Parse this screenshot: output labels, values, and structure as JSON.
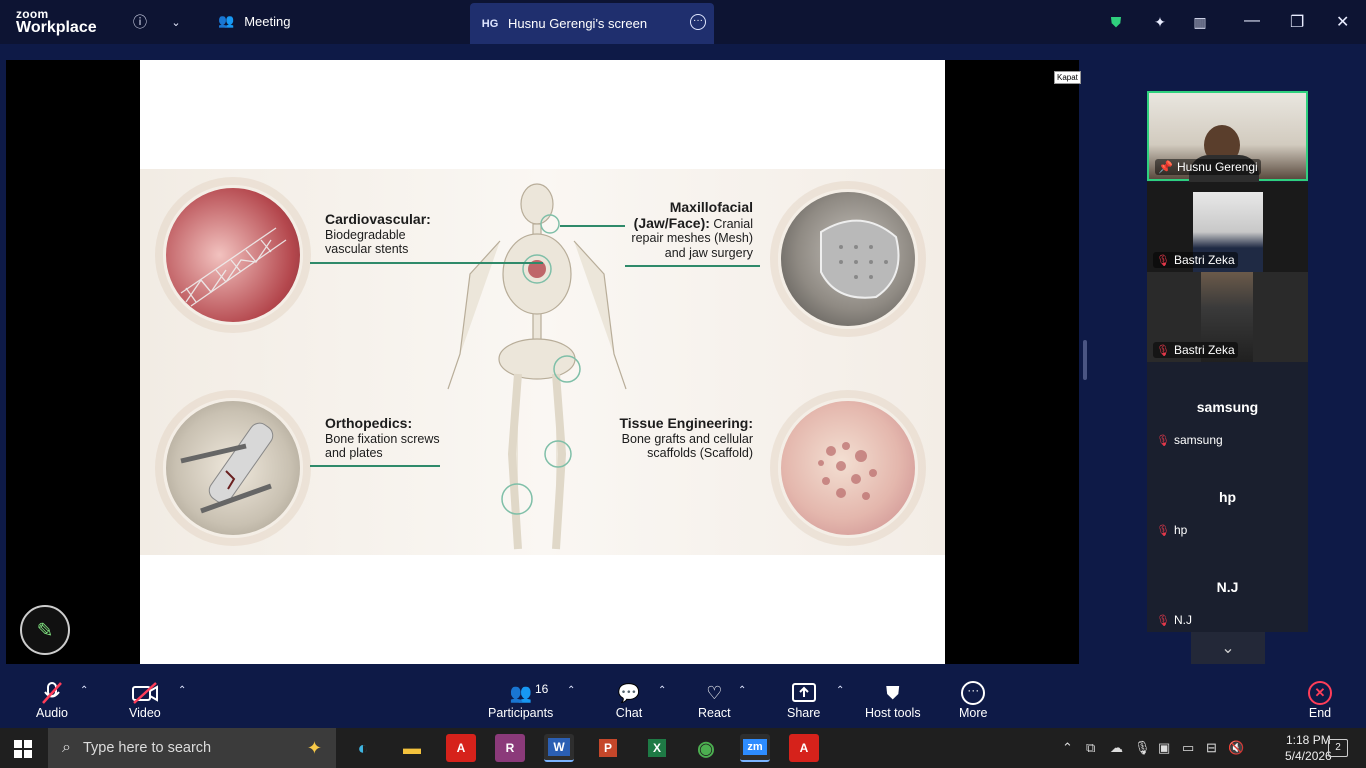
{
  "app": {
    "brand_top": "zoom",
    "brand_bottom": "Workplace"
  },
  "topbar": {
    "meeting_label": "Meeting",
    "share_badge": "HG",
    "share_title": "Husnu Gerengi's screen"
  },
  "slide": {
    "cardio_title": "Cardiovascular:",
    "cardio_text": "Biodegradable vascular stents",
    "maxillo_title": "Maxillofacial (Jaw/Face):",
    "maxillo_text": "Cranial repair meshes (Mesh) and jaw surgery",
    "ortho_title": "Orthopedics:",
    "ortho_text": "Bone fixation screws and plates",
    "tissue_title": "Tissue Engineering:",
    "tissue_text": "Bone grafts and cellular scaffolds (Scaffold)"
  },
  "kapat": "Kapat",
  "participants": [
    {
      "name": "Husnu Gerengi"
    },
    {
      "name": "Bastri Zeka"
    },
    {
      "name": "Bastri Zeka"
    },
    {
      "name": "samsung",
      "big": "samsung"
    },
    {
      "name": "hp",
      "big": "hp"
    },
    {
      "name": "N.J",
      "big": "N.J"
    }
  ],
  "toolbar": {
    "audio": "Audio",
    "video": "Video",
    "participants": "Participants",
    "participants_count": "16",
    "chat": "Chat",
    "react": "React",
    "share": "Share",
    "host_tools": "Host tools",
    "more": "More",
    "end": "End"
  },
  "taskbar": {
    "search_placeholder": "Type here to search",
    "time": "1:18 PM",
    "date": "5/4/2026",
    "notifications": "2"
  },
  "colors": {
    "accent": "#2fd07e",
    "end": "#ff3d59",
    "connector": "#2f8a6a"
  }
}
